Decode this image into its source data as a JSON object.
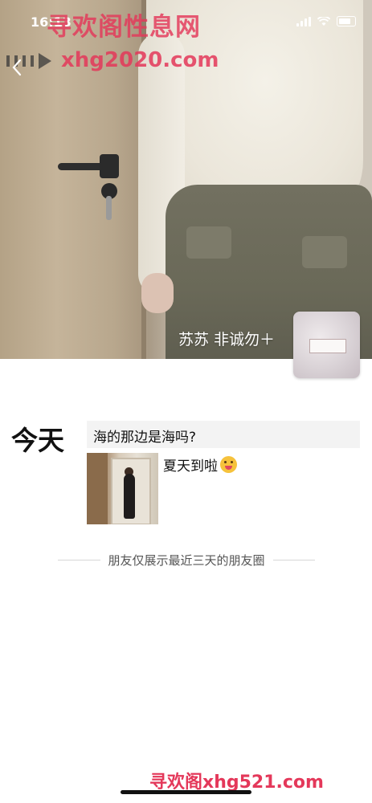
{
  "status_bar": {
    "time": "16:13"
  },
  "watermarks": {
    "top_cn": "寻欢阁性息网",
    "top_url": "xhg2020.com",
    "bottom": "寻欢阁xhg521.com"
  },
  "profile": {
    "name": "苏苏 非诚勿＋"
  },
  "feed": {
    "date_label": "今天",
    "posts": [
      {
        "text": "海的那边是海吗?"
      },
      {
        "caption": "夏天到啦",
        "emoji": "face-with-tongue-emoji"
      }
    ],
    "footer_note": "朋友仅展示最近三天的朋友圈"
  },
  "colors": {
    "watermark": "#e4385a",
    "text_primary": "#111111",
    "text_secondary": "#555555",
    "post_bg": "#f3f3f3"
  }
}
